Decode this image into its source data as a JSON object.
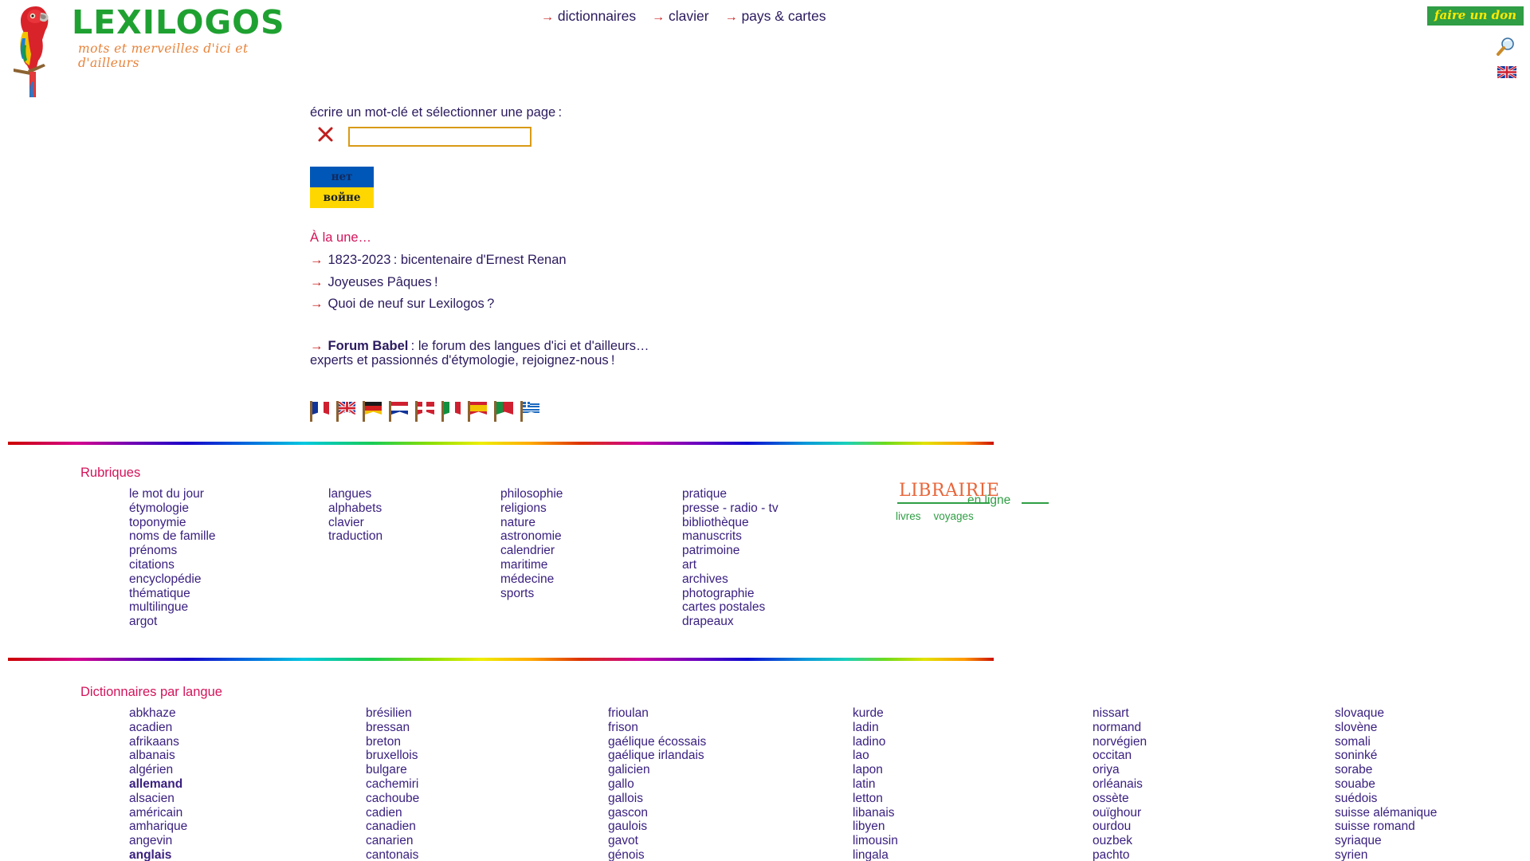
{
  "header": {
    "logo_word": "LEXILOGOS",
    "logo_tagline": "mots et merveilles d'ici et d'ailleurs",
    "nav": [
      {
        "arrow": "→",
        "label": "dictionnaires"
      },
      {
        "arrow": "→",
        "label": "clavier"
      },
      {
        "arrow": "→",
        "label": "pays & cartes"
      }
    ],
    "donate_label": "faire un don",
    "search_icon": "magnifier-icon",
    "language_flag": "uk-flag-icon"
  },
  "search": {
    "label": "écrire un mot-clé et sélectionner une page :",
    "clear_icon": "red-x-icon",
    "value": "",
    "placeholder": ""
  },
  "ukraine_banner": {
    "top_text": "нет",
    "bottom_text": "войне",
    "top_color": "#0057b7",
    "bottom_color": "#ffd700"
  },
  "alaune": {
    "title": "À la une…",
    "arrow": "→",
    "items": [
      "1823-2023 : bicentenaire d'Ernest Renan",
      "Joyeuses Pâques !",
      "Quoi de neuf sur Lexilogos ?"
    ],
    "babel_link": "Forum Babel",
    "babel_rest": " : le forum des langues d'ici et d'ailleurs…",
    "babel_sub": "experts et passionnés d'étymologie, rejoignez-nous !"
  },
  "flags": [
    {
      "name": "france-flag",
      "colors": [
        "#11349a",
        "#ffffff",
        "#cf2030"
      ]
    },
    {
      "name": "united-kingdom-flag",
      "colors": [
        "#11349a",
        "#ffffff",
        "#cf2030"
      ]
    },
    {
      "name": "germany-flag",
      "colors": [
        "#1a1a1a",
        "#d22020",
        "#f2c300"
      ]
    },
    {
      "name": "netherlands-flag",
      "colors": [
        "#cf2030",
        "#ffffff",
        "#11349a"
      ]
    },
    {
      "name": "denmark-flag",
      "colors": [
        "#cf2030",
        "#ffffff",
        "#cf2030"
      ]
    },
    {
      "name": "italy-flag",
      "colors": [
        "#109040",
        "#ffffff",
        "#cf2030"
      ]
    },
    {
      "name": "spain-flag",
      "colors": [
        "#cf2030",
        "#f2c300",
        "#cf2030"
      ]
    },
    {
      "name": "portugal-flag",
      "colors": [
        "#109040",
        "#109040",
        "#cf2030"
      ]
    },
    {
      "name": "greece-flag",
      "colors": [
        "#ffffff",
        "#1b69c0",
        "#ffffff"
      ]
    }
  ],
  "rubriques": {
    "title": "Rubriques",
    "columns": [
      [
        "le mot du jour",
        "étymologie",
        "toponymie",
        "noms de famille",
        "prénoms",
        "citations",
        "encyclopédie",
        "thématique",
        "multilingue",
        "argot"
      ],
      [
        "langues",
        "alphabets",
        "clavier",
        "traduction"
      ],
      [
        "philosophie",
        "religions",
        "nature",
        "astronomie",
        "calendrier",
        "maritime",
        "médecine",
        "sports"
      ],
      [
        "pratique",
        "presse - radio - tv",
        "bibliothèque",
        "manuscrits",
        "patrimoine",
        "art",
        "archives",
        "photographie",
        "cartes postales",
        "drapeaux"
      ]
    ]
  },
  "librairie": {
    "word": "LIBRAIRIE",
    "subtitle": "en ligne",
    "links": [
      "livres",
      "voyages"
    ]
  },
  "dictionnaires": {
    "title": "Dictionnaires par langue",
    "columns": [
      [
        {
          "label": "abkhaze"
        },
        {
          "label": "acadien"
        },
        {
          "label": "afrikaans"
        },
        {
          "label": "albanais"
        },
        {
          "label": "algérien"
        },
        {
          "label": "allemand",
          "major": true
        },
        {
          "label": "alsacien"
        },
        {
          "label": "américain"
        },
        {
          "label": "amharique"
        },
        {
          "label": "angevin"
        },
        {
          "label": "anglais",
          "major": true
        }
      ],
      [
        {
          "label": "brésilien"
        },
        {
          "label": "bressan"
        },
        {
          "label": "breton"
        },
        {
          "label": "bruxellois"
        },
        {
          "label": "bulgare"
        },
        {
          "label": "cachemiri"
        },
        {
          "label": "cachoube"
        },
        {
          "label": "cadien"
        },
        {
          "label": "canadien"
        },
        {
          "label": "canarien"
        },
        {
          "label": "cantonais"
        }
      ],
      [
        {
          "label": "frioulan"
        },
        {
          "label": "frison"
        },
        {
          "label": "gaélique écossais"
        },
        {
          "label": "gaélique irlandais"
        },
        {
          "label": "galicien"
        },
        {
          "label": "gallo"
        },
        {
          "label": "gallois"
        },
        {
          "label": "gascon"
        },
        {
          "label": "gaulois"
        },
        {
          "label": "gavot"
        },
        {
          "label": "génois"
        }
      ],
      [
        {
          "label": "kurde"
        },
        {
          "label": "ladin"
        },
        {
          "label": "ladino"
        },
        {
          "label": "lao"
        },
        {
          "label": "lapon"
        },
        {
          "label": "latin"
        },
        {
          "label": "letton"
        },
        {
          "label": "libanais"
        },
        {
          "label": "libyen"
        },
        {
          "label": "limousin"
        },
        {
          "label": "lingala"
        }
      ],
      [
        {
          "label": "nissart"
        },
        {
          "label": "normand"
        },
        {
          "label": "norvégien"
        },
        {
          "label": "occitan"
        },
        {
          "label": "oriya"
        },
        {
          "label": "orléanais"
        },
        {
          "label": "ossète"
        },
        {
          "label": "ouïghour"
        },
        {
          "label": "ourdou"
        },
        {
          "label": "ouzbek"
        },
        {
          "label": "pachto"
        }
      ],
      [
        {
          "label": "slovaque"
        },
        {
          "label": "slovène"
        },
        {
          "label": "somali"
        },
        {
          "label": "soninké"
        },
        {
          "label": "sorabe"
        },
        {
          "label": "souabe"
        },
        {
          "label": "suédois"
        },
        {
          "label": "suisse alémanique"
        },
        {
          "label": "suisse romand"
        },
        {
          "label": "syriaque"
        },
        {
          "label": "syrien"
        }
      ]
    ]
  },
  "colors": {
    "link": "#3a2080",
    "heading": "#d4145a",
    "logo_green": "#1fa131",
    "logo_orange": "#e8833a",
    "input_border": "#d99a16",
    "donate_bg": "#2f9e44",
    "donate_fg": "#ffe900"
  }
}
